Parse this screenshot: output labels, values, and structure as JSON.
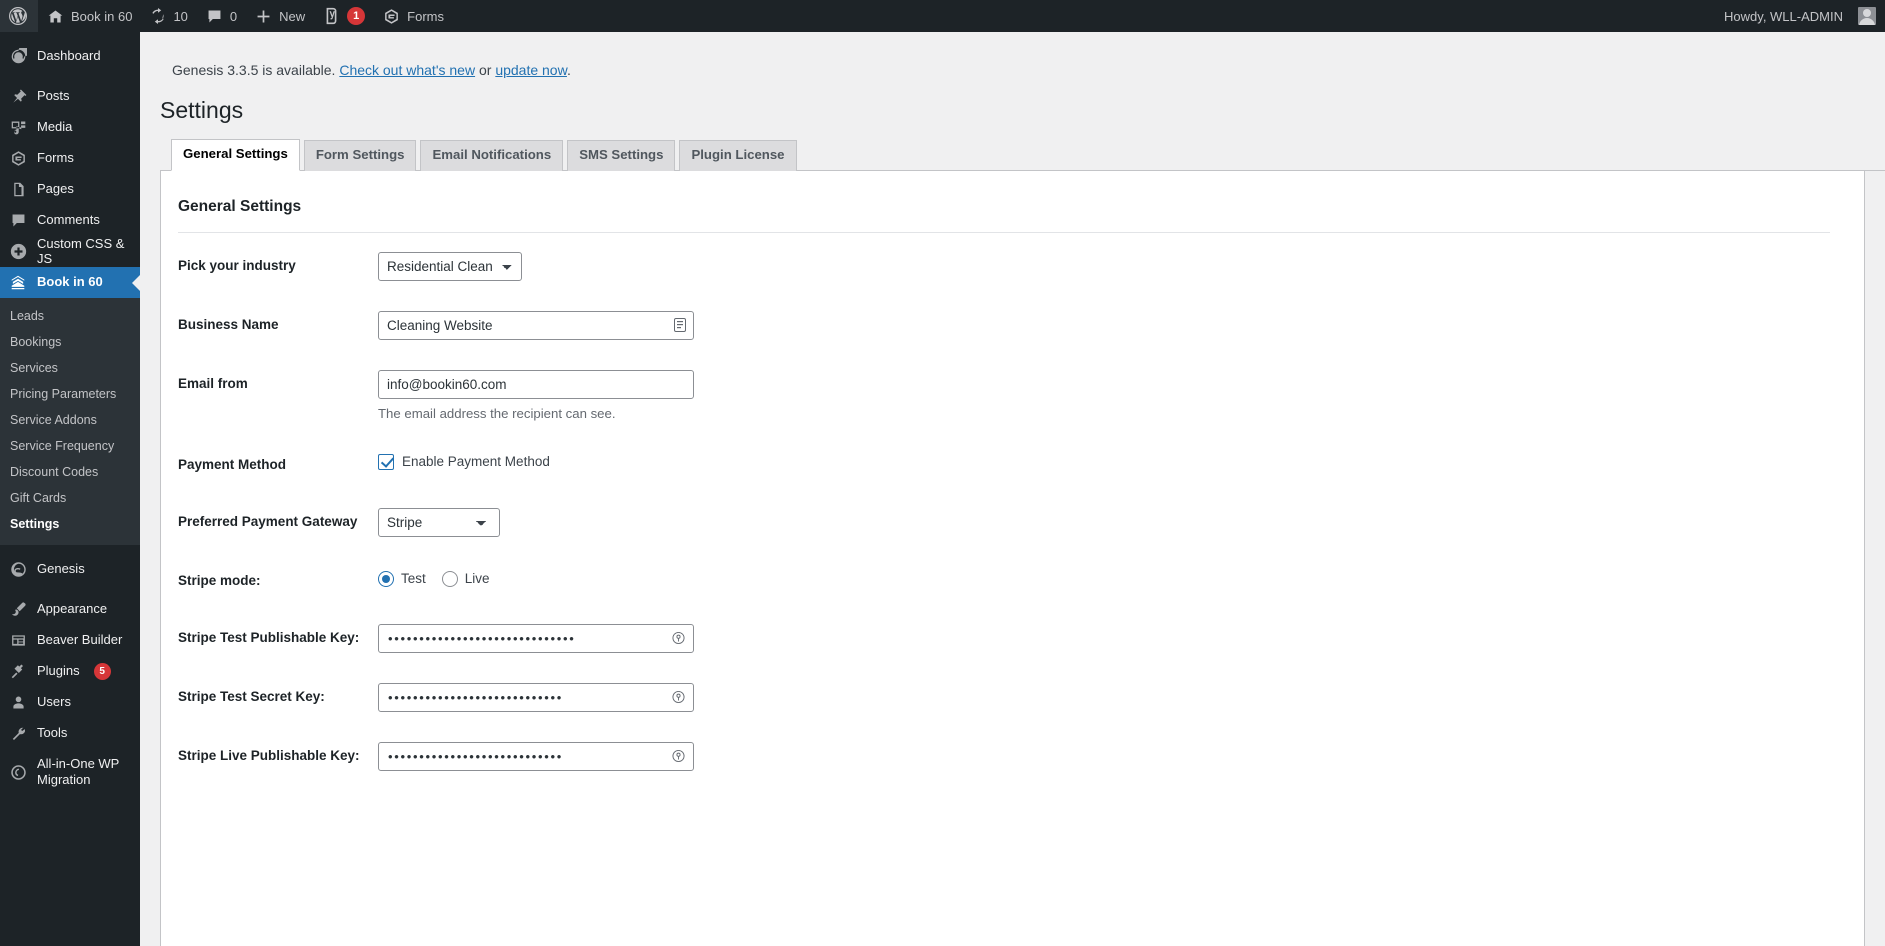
{
  "adminbar": {
    "logo_icon": "wordpress-logo-icon",
    "site_name": "Book in 60",
    "site_icon": "home-icon",
    "updates_icon": "updates-icon",
    "updates_count": "10",
    "comments_icon": "comment-bubble-icon",
    "comments_count": "0",
    "new_icon": "plus-icon",
    "new_label": "New",
    "seo_icon": "yoast-seo-icon",
    "seo_count": "1",
    "forms_icon": "gravity-forms-icon",
    "forms_label": "Forms",
    "howdy": "Howdy, WLL-ADMIN",
    "avatar": "user-avatar"
  },
  "sidebar": {
    "items": [
      {
        "label": "Dashboard",
        "icon": "dashboard-icon",
        "current": false,
        "badge": ""
      },
      {
        "label": "Posts",
        "icon": "pin-icon",
        "current": false,
        "badge": ""
      },
      {
        "label": "Media",
        "icon": "media-icon",
        "current": false,
        "badge": ""
      },
      {
        "label": "Forms",
        "icon": "gravity-forms-icon",
        "current": false,
        "badge": ""
      },
      {
        "label": "Pages",
        "icon": "pages-icon",
        "current": false,
        "badge": ""
      },
      {
        "label": "Comments",
        "icon": "comment-bubble-icon",
        "current": false,
        "badge": ""
      },
      {
        "label": "Custom CSS & JS",
        "icon": "plus-circle-icon",
        "current": false,
        "badge": ""
      },
      {
        "label": "Book in 60",
        "icon": "bookin60-icon",
        "current": true,
        "badge": ""
      }
    ],
    "submenu": [
      {
        "label": "Leads",
        "current": false
      },
      {
        "label": "Bookings",
        "current": false
      },
      {
        "label": "Services",
        "current": false
      },
      {
        "label": "Pricing Parameters",
        "current": false
      },
      {
        "label": "Service Addons",
        "current": false
      },
      {
        "label": "Service Frequency",
        "current": false
      },
      {
        "label": "Discount Codes",
        "current": false
      },
      {
        "label": "Gift Cards",
        "current": false
      },
      {
        "label": "Settings",
        "current": true
      }
    ],
    "items_after": [
      {
        "label": "Genesis",
        "icon": "genesis-icon",
        "badge": ""
      },
      {
        "label": "Appearance",
        "icon": "paintbrush-icon",
        "badge": ""
      },
      {
        "label": "Beaver Builder",
        "icon": "beaver-builder-icon",
        "badge": ""
      },
      {
        "label": "Plugins",
        "icon": "plug-icon",
        "badge": "5"
      },
      {
        "label": "Users",
        "icon": "user-icon",
        "badge": ""
      },
      {
        "label": "Tools",
        "icon": "wrench-icon",
        "badge": ""
      },
      {
        "label": "All-in-One WP Migration",
        "icon": "migration-icon",
        "badge": ""
      }
    ]
  },
  "notice": {
    "text_before": "Genesis 3.3.5 is available. ",
    "link1": "Check out what's new",
    "text_mid": " or ",
    "link2": "update now",
    "text_after": "."
  },
  "page": {
    "title": "Settings"
  },
  "tabs": [
    {
      "label": "General Settings",
      "active": true
    },
    {
      "label": "Form Settings",
      "active": false
    },
    {
      "label": "Email Notifications",
      "active": false
    },
    {
      "label": "SMS Settings",
      "active": false
    },
    {
      "label": "Plugin License",
      "active": false
    }
  ],
  "panel": {
    "section_title": "General Settings",
    "fields": {
      "industry": {
        "label": "Pick your industry",
        "value": "Residential Cleaning",
        "options": [
          "Residential Cleaning"
        ]
      },
      "business_name": {
        "label": "Business Name",
        "value": "Cleaning Website",
        "glyph": "copy-icon"
      },
      "email_from": {
        "label": "Email from",
        "value": "info@bookin60.com",
        "description": "The email address the recipient can see."
      },
      "payment_method": {
        "label": "Payment Method",
        "checkbox_label": "Enable Payment Method",
        "checked": true
      },
      "gateway": {
        "label": "Preferred Payment Gateway",
        "value": "Stripe",
        "options": [
          "Stripe"
        ]
      },
      "stripe_mode": {
        "label": "Stripe mode:",
        "options": [
          "Test",
          "Live"
        ],
        "selected": "Test"
      },
      "stripe_test_pub": {
        "label": "Stripe Test Publishable Key:",
        "value": "••••••••••••••••••••••••••••••",
        "glyph": "reveal-key-icon"
      },
      "stripe_test_secret": {
        "label": "Stripe Test Secret Key:",
        "value": "••••••••••••••••••••••••••••",
        "glyph": "reveal-key-icon"
      },
      "stripe_live_pub": {
        "label": "Stripe Live Publishable Key:",
        "value": "••••••••••••••••••••••••••••",
        "glyph": "reveal-key-icon"
      }
    }
  },
  "colors": {
    "admin_dark": "#1d2327",
    "admin_submenu": "#2c3338",
    "accent_blue": "#2271b1",
    "badge_red": "#d63638",
    "page_bg": "#f0f0f1"
  }
}
